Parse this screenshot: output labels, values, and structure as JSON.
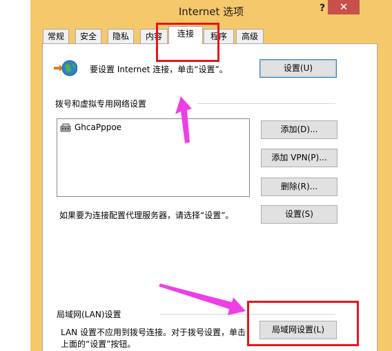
{
  "window": {
    "title": "Internet 选项",
    "help_label": "?",
    "close_label": "✕",
    "frame_color": "#f6c86c",
    "close_color": "#c7504a"
  },
  "tabs": [
    {
      "label": "常规"
    },
    {
      "label": "安全"
    },
    {
      "label": "隐私"
    },
    {
      "label": "内容"
    },
    {
      "label": "连接",
      "active": true
    },
    {
      "label": "程序"
    },
    {
      "label": "高级"
    }
  ],
  "setup": {
    "icon": "globe-network-icon",
    "text": "要设置 Internet 连接，单击“设置”。",
    "button": "设置(U)"
  },
  "dialup": {
    "section_title": "拨号和虚拟专用网络设置",
    "connections": [
      {
        "icon": "dialup-connection-icon",
        "name": "GhcaPppoe"
      }
    ],
    "add_button": "添加(D)...",
    "add_vpn_button": "添加 VPN(P)...",
    "remove_button": "删除(R)...",
    "proxy_text": "如果要为连接配置代理服务器，请选择“设置”。",
    "settings_button": "设置(S)"
  },
  "lan": {
    "section_title": "局域网(LAN)设置",
    "description_line1": "LAN 设置不应用到拨号连接。对于拨号设置，单击",
    "description_line2": "上面的“设置”按钮。",
    "button": "局域网设置(L)"
  },
  "annotations": {
    "highlight_color": "#e8131c",
    "arrow_color": "#ee3fe6"
  }
}
